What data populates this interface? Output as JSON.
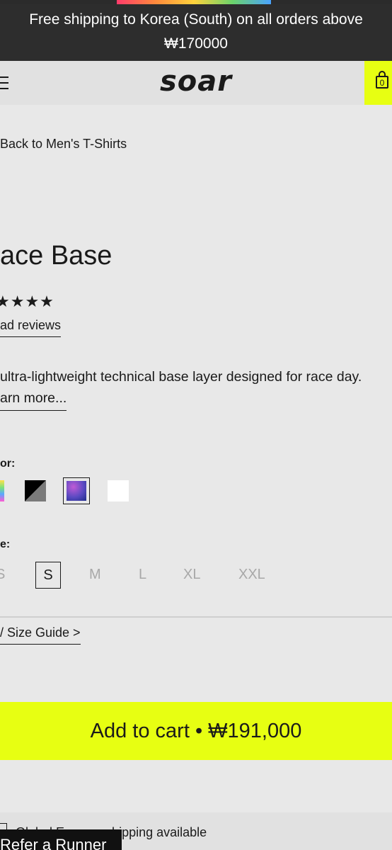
{
  "banner": {
    "text": "Free shipping to Korea (South) on all orders above ₩170000"
  },
  "header": {
    "logo": "soar",
    "cart_count": "0"
  },
  "breadcrumb": {
    "back_label": "Back to Men's T-Shirts"
  },
  "product": {
    "title": "ace Base",
    "stars": "★★★★",
    "reviews_label": "ad reviews",
    "description": "ultra-lightweight technical base layer designed for race day.",
    "learn_more_label": "arn more..."
  },
  "color": {
    "label": "or:",
    "swatches": [
      "rainbow",
      "black-grey",
      "purple-gradient",
      "white"
    ],
    "selected": "purple-gradient"
  },
  "size": {
    "label": "e:",
    "options": [
      "S",
      "S",
      "M",
      "L",
      "XL",
      "XXL"
    ],
    "selected": "S"
  },
  "size_guide": {
    "label": "/ Size Guide >"
  },
  "cart": {
    "button_label": "Add to cart  •  ₩191,000"
  },
  "shipping": {
    "text": "Global Express shipping available"
  },
  "refer": {
    "label": "Refer a Runner"
  },
  "colors": {
    "accent": "#e7ff12",
    "banner_bg": "#2d2d2d",
    "page_bg": "#e8e8e8"
  }
}
